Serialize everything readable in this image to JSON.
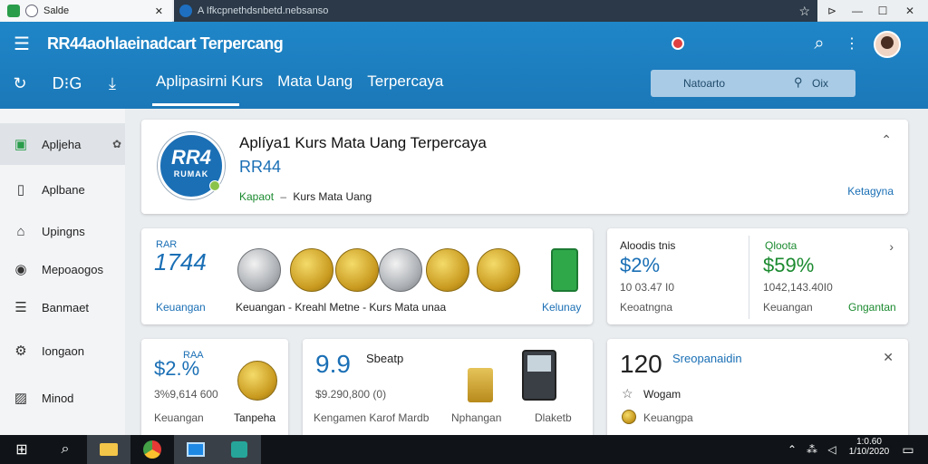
{
  "browser": {
    "tab1_title": "Salde",
    "tab2_address": "A  Ifkcpnethdsnbetd.nebsanso",
    "minimize": "—",
    "maximize": "☐",
    "close": "✕"
  },
  "header": {
    "title": "RR44aohlaeinadcart Terpercang",
    "subnav": [
      "Aplipasirni Kurs",
      "Mata Uang",
      "Terpercaya"
    ],
    "search_placeholder": "Natoarto",
    "search_button": "Oix"
  },
  "sidebar": {
    "items": [
      {
        "label": "Apljeha",
        "icon": "app-icon"
      },
      {
        "label": "Aplbane",
        "icon": "document-icon"
      },
      {
        "label": "Upingns",
        "icon": "home-icon"
      },
      {
        "label": "Mepoaogos",
        "icon": "record-icon"
      },
      {
        "label": "Banmaet",
        "icon": "list-icon"
      },
      {
        "label": "Iongaon",
        "icon": "gear-icon"
      },
      {
        "label": "Minod",
        "icon": "image-icon"
      }
    ]
  },
  "hero": {
    "logo_text": "RR4",
    "logo_subtext": "RUMAK",
    "title": "Aplíya1 Kurs Mata Uang Terpercaya",
    "subtitle": "RR44",
    "category": "Kapaot",
    "tagline": "Kurs Mata Uang",
    "link": "Ketagyna"
  },
  "card_coins": {
    "brand": "RAR",
    "number": "1744",
    "footer_left": "Keuangan",
    "footer_mid": "Keuangan - Kreahl Metne - Kurs Mata unaa",
    "footer_right": "Kelunay"
  },
  "card_stats": {
    "left_label": "Aloodis tnis",
    "left_value": "$2%",
    "left_sub": "10 03.47 I0",
    "left_footer": "Keoatngna",
    "right_label": "Qloota",
    "right_value": "$59%",
    "right_sub": "1042,143.40I0",
    "right_footer": "Keuangan",
    "right_link": "Gngantan"
  },
  "card_a": {
    "brand": "RAA",
    "value": "$2.%",
    "sub": "3%9,614 600",
    "footer_left": "Keuangan",
    "footer_right": "Tanpeha"
  },
  "card_b": {
    "value": "9.9",
    "label": "Sbeatp",
    "sub": "$9.290,800 (0)",
    "footer_left": "Kengamen Karof Mardb",
    "footer_mid": "Nphangan",
    "footer_right": "Dlaketb"
  },
  "card_c": {
    "value": "120",
    "label": "Sreopanaidin",
    "line1": "Wogam",
    "line2": "Keuangpa"
  },
  "taskbar": {
    "time": "1:0.60",
    "date": "1/10/2020"
  },
  "colors": {
    "header": "#1f7fc2",
    "accent_green": "#1b8a2f",
    "accent_blue": "#1a6fb5"
  }
}
